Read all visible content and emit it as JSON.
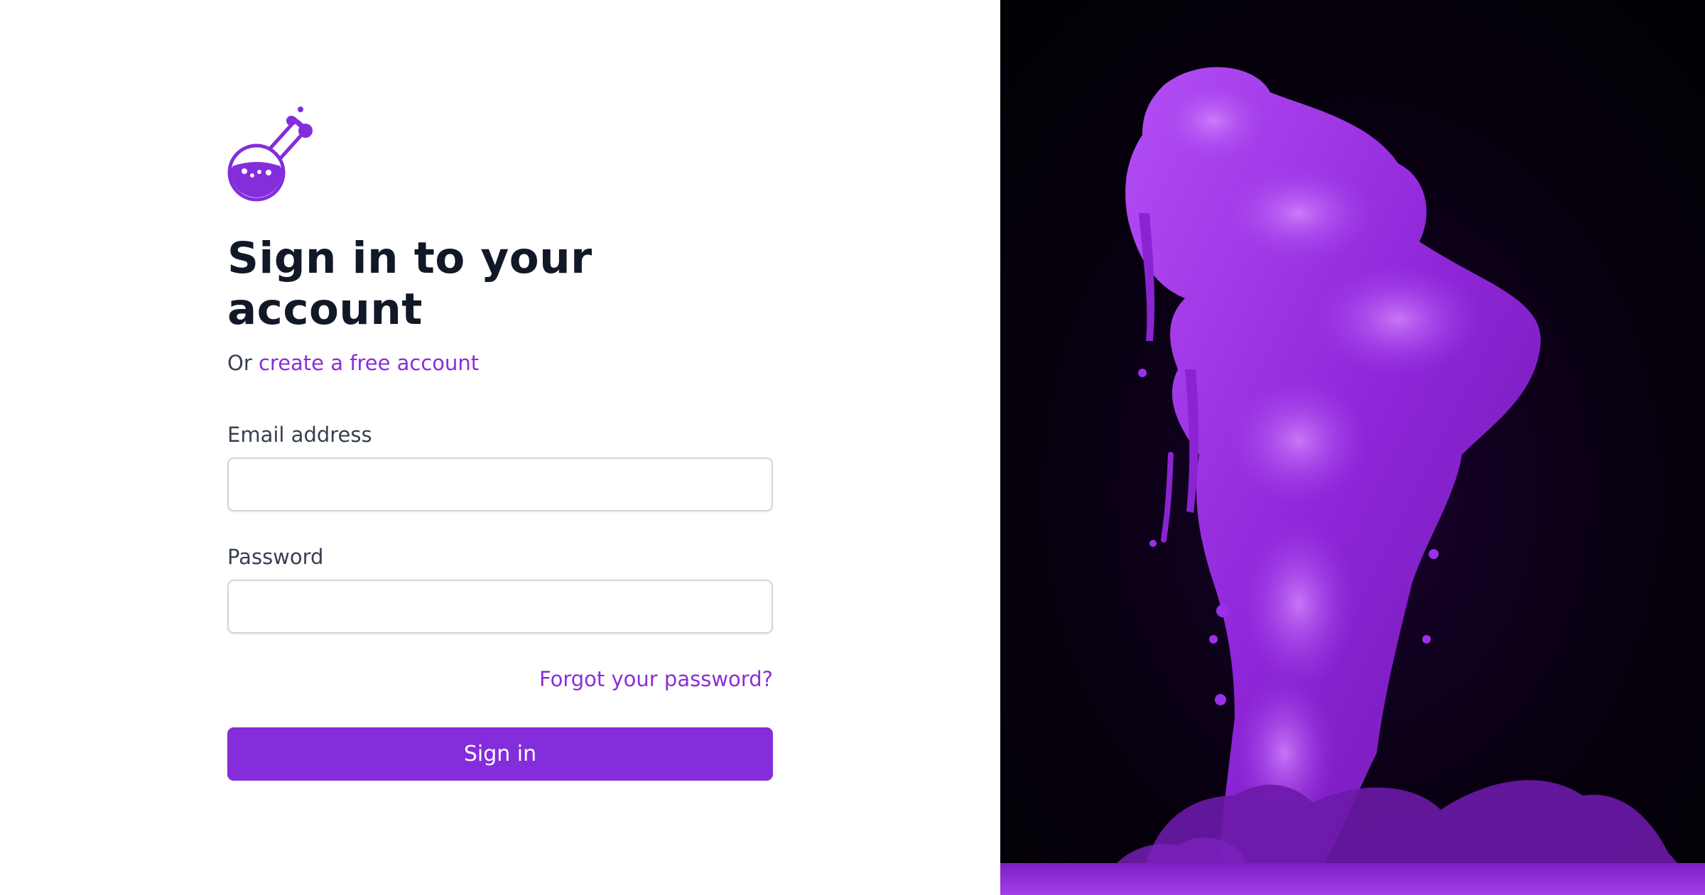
{
  "header": {
    "title": "Sign in to your account",
    "subtitle_prefix": "Or",
    "create_account_link": "create a free account"
  },
  "form": {
    "email_label": "Email address",
    "email_value": "",
    "password_label": "Password",
    "password_value": "",
    "forgot_link": "Forgot your password?",
    "submit_label": "Sign in"
  },
  "logo": {
    "icon": "flask-icon",
    "color": "#832ddb"
  },
  "hero": {
    "subject": "purple-ink-smoke",
    "background_color": "#05000a",
    "accent_color": "#9b30e8"
  },
  "colors": {
    "brand": "#832ddb",
    "link": "#8b2ed6",
    "heading": "#111827",
    "text": "#374151",
    "input_border": "#d1d5db"
  }
}
